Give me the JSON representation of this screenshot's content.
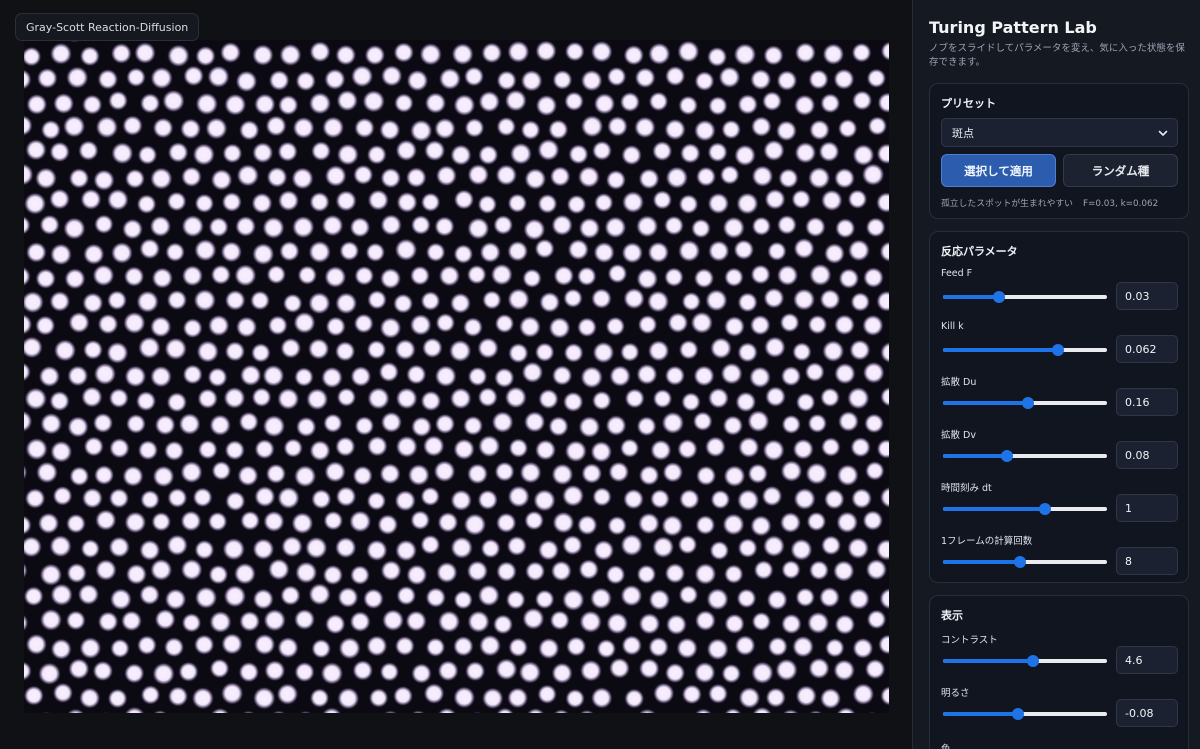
{
  "canvas": {
    "label": "Gray-Scott Reaction-Diffusion"
  },
  "panel": {
    "title": "Turing Pattern Lab",
    "description": "ノブをスライドしてパラメータを変え、気に入った状態を保存できます。"
  },
  "preset": {
    "heading": "プリセット",
    "selected": "斑点",
    "apply_label": "選択して適用",
    "random_label": "ランダム種",
    "note": "孤立したスポットが生まれやすい",
    "note_params": "F=0.03, k=0.062"
  },
  "reaction": {
    "heading": "反応パラメータ",
    "params": [
      {
        "label": "Feed F",
        "value": "0.03",
        "fraction": 0.34
      },
      {
        "label": "Kill k",
        "value": "0.062",
        "fraction": 0.7
      },
      {
        "label": "拡散 Du",
        "value": "0.16",
        "fraction": 0.52
      },
      {
        "label": "拡散 Dv",
        "value": "0.08",
        "fraction": 0.39
      },
      {
        "label": "時間刻み dt",
        "value": "1",
        "fraction": 0.62
      },
      {
        "label": "1フレームの計算回数",
        "value": "8",
        "fraction": 0.47
      }
    ]
  },
  "display": {
    "heading": "表示",
    "params": [
      {
        "label": "コントラスト",
        "value": "4.6",
        "fraction": 0.55
      },
      {
        "label": "明るさ",
        "value": "-0.08",
        "fraction": 0.46
      }
    ],
    "color_label": "色"
  }
}
